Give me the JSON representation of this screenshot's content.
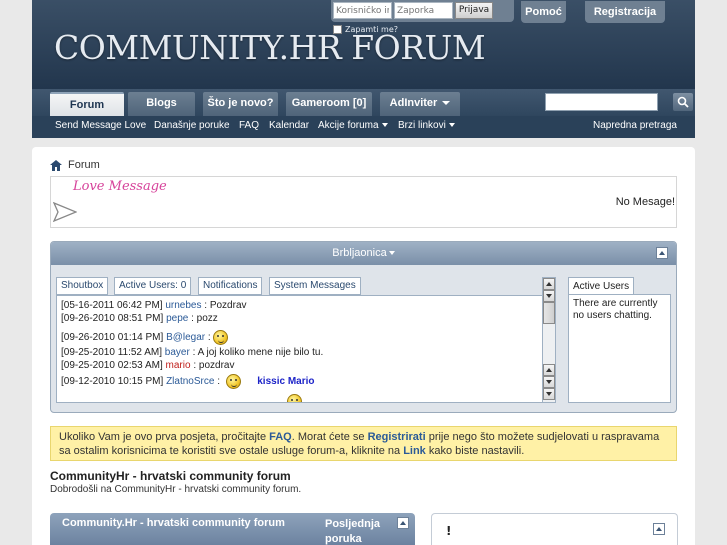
{
  "header": {
    "logo": "COMMUNITY.HR FORUM",
    "login": {
      "username_placeholder": "Korisničko ime",
      "password_placeholder": "Zaporka",
      "login_button": "Prijava",
      "remember_me": "Zapamti me?"
    },
    "help_button": "Pomoć",
    "register_button": "Registracija"
  },
  "nav": {
    "tabs": [
      {
        "label": "Forum"
      },
      {
        "label": "Blogs"
      },
      {
        "label": "Što je novo?"
      },
      {
        "label": "Gameroom [0]"
      },
      {
        "label": "AdInviter"
      }
    ],
    "search_placeholder": ""
  },
  "subnav": {
    "items": [
      {
        "label": "Send Message Love"
      },
      {
        "label": "Današnje poruke"
      },
      {
        "label": "FAQ"
      },
      {
        "label": "Kalendar"
      },
      {
        "label": "Akcije foruma"
      },
      {
        "label": "Brzi linkovi"
      }
    ],
    "advanced_search": "Napredna pretraga"
  },
  "breadcrumb": {
    "label": "Forum"
  },
  "love_message": {
    "title": "Love Message",
    "message": "No Mesage!"
  },
  "shoutbox": {
    "title": "Brbljaonica",
    "tabs": {
      "shoutbox": "Shoutbox",
      "active_users": "Active Users",
      "active_users_count": "0",
      "notifications": "Notifications",
      "system_messages": "System Messages"
    },
    "messages": [
      {
        "time": "[05-16-2011 06:42 PM]",
        "user": "urnebes",
        "text": "Pozdrav"
      },
      {
        "time": "[09-26-2010 08:51 PM]",
        "user": "pepe",
        "text": "pozz"
      },
      {
        "time": "[09-26-2010 01:14 PM]",
        "user": "B@legar",
        "text": ""
      },
      {
        "time": "[09-25-2010 11:52 AM]",
        "user": "bayer",
        "text": "A joj koliko mene nije bilo tu."
      },
      {
        "time": "[09-25-2010 02:53 AM]",
        "user": "mario",
        "text": "pozdrav"
      },
      {
        "time": "[09-12-2010 10:15 PM]",
        "user": "ZlatnoSrce",
        "text": "kissic Mario"
      }
    ],
    "active_panel_title": "Active Users",
    "active_panel_text": "There are currently no users chatting."
  },
  "notice": {
    "part1": "Ukoliko Vam je ovo prva posjeta, pročitajte ",
    "faq_link": "FAQ",
    "part2": ". Morat ćete se ",
    "register_link": "Registrirati",
    "part3": " prije nego što možete sudjelovati u raspravama sa ostalim korisnicima te koristiti sve ostale usluge forum-a, kliknite na ",
    "link_link": "Link",
    "part4": " kako biste nastavili."
  },
  "forum": {
    "title": "CommunityHr - hrvatski community forum",
    "description": "Dobrodošli na CommunityHr - hrvatski community forum."
  },
  "category": {
    "title": "Community.Hr - hrvatski community forum",
    "last_post_line1": "Posljednja",
    "last_post_line2": "poruka"
  },
  "side_box": {
    "title": "!"
  },
  "colors": {
    "header_bg": "#2f445c",
    "nav_active": "#eef0f2",
    "notice_bg": "#fff1a6",
    "link": "#2b5a97"
  }
}
